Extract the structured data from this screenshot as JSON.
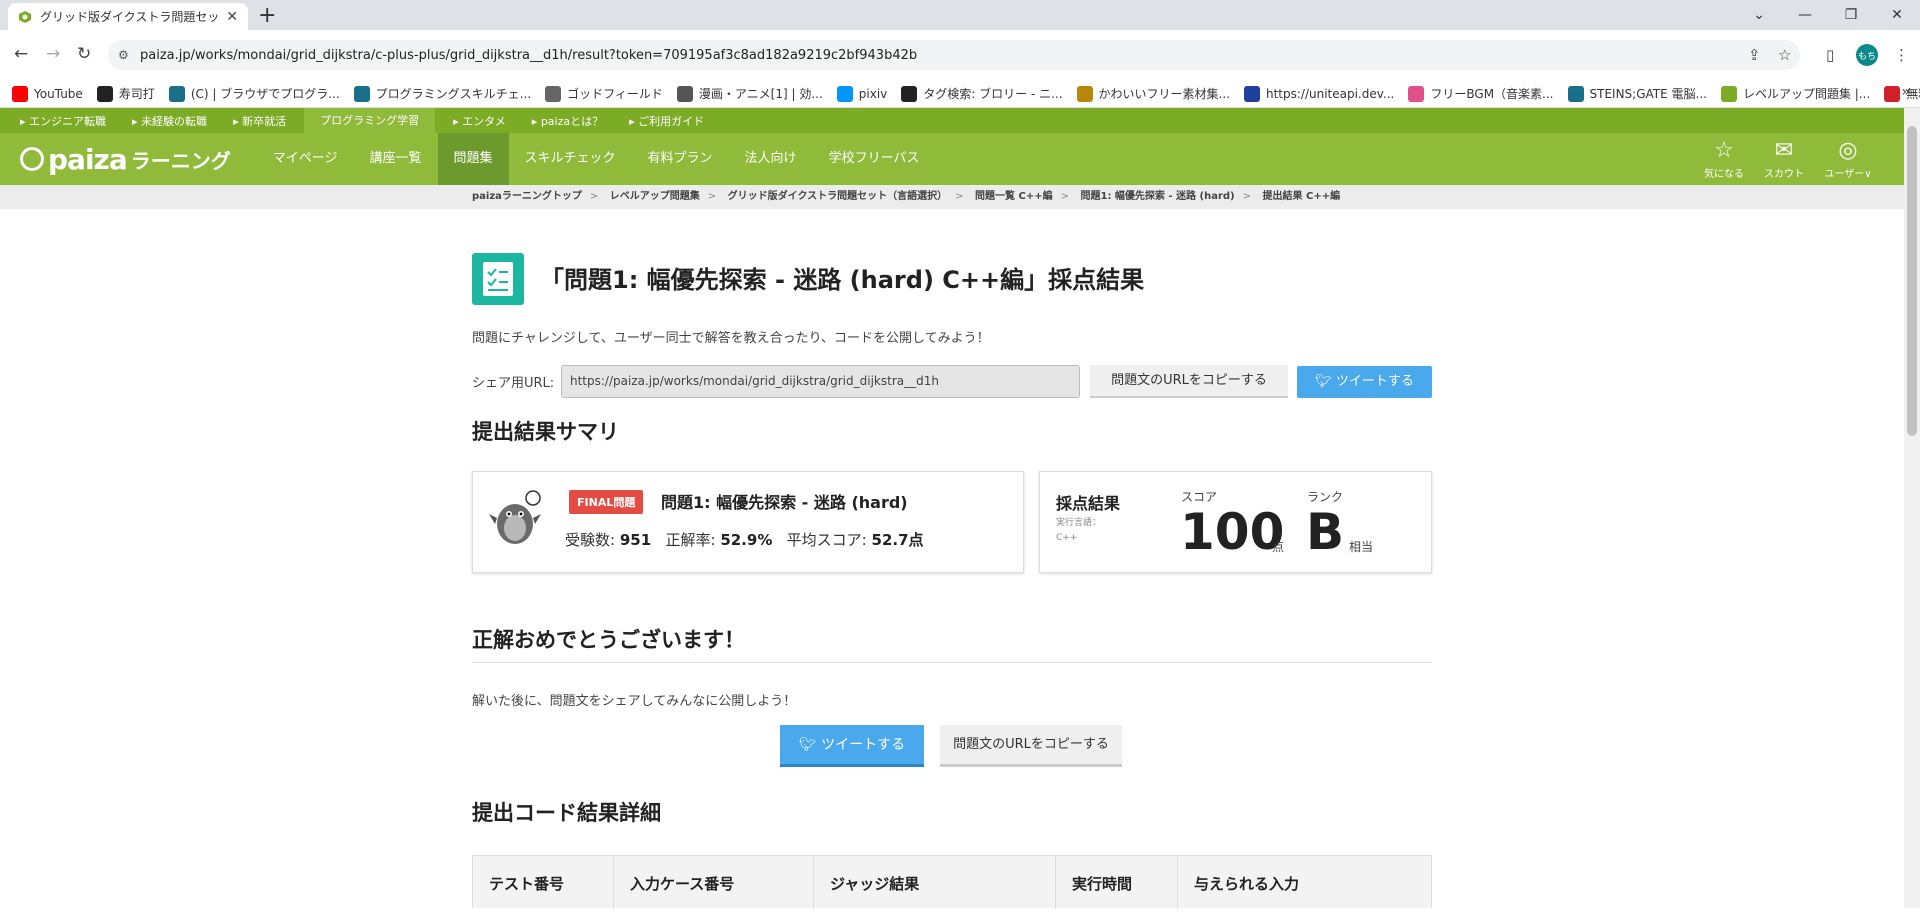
{
  "browser": {
    "tab_title": "グリッド版ダイクストラ問題セット(C++",
    "url": "paiza.jp/works/mondai/grid_dijkstra/c-plus-plus/grid_dijkstra__d1h/result?token=709195af3c8ad182a9219c2bf943b42b",
    "profile_initials": "もち",
    "bookmarks": [
      {
        "label": "YouTube",
        "color": "#ff0000"
      },
      {
        "label": "寿司打",
        "color": "#222222"
      },
      {
        "label": "(C) | ブラウザでプログラ...",
        "color": "#1a6f8a"
      },
      {
        "label": "プログラミングスキルチェ...",
        "color": "#1a6f8a"
      },
      {
        "label": "ゴッドフィールド",
        "color": "#666666"
      },
      {
        "label": "漫画・アニメ[1] | 効...",
        "color": "#555555"
      },
      {
        "label": "pixiv",
        "color": "#0096fa"
      },
      {
        "label": "タグ検索: ブロリー - ニ...",
        "color": "#222222"
      },
      {
        "label": "かわいいフリー素材集...",
        "color": "#b8860b"
      },
      {
        "label": "https://uniteapi.dev...",
        "color": "#2040a0"
      },
      {
        "label": "フリーBGM（音楽素...",
        "color": "#e0508a"
      },
      {
        "label": "STEINS;GATE 電脳...",
        "color": "#1a6f8a"
      },
      {
        "label": "レベルアップ問題集 |...",
        "color": "#7cab26"
      },
      {
        "label": "無料イラストなら「イラ...",
        "color": "#d0202a"
      }
    ]
  },
  "site": {
    "top_links": [
      "エンジニア転職",
      "未経験の転職",
      "新卒就活",
      "プログラミング学習",
      "エンタメ",
      "paizaとは？",
      "ご利用ガイド"
    ],
    "logo_main": "paiza",
    "logo_sub": "ラーニング",
    "main_nav": [
      "マイページ",
      "講座一覧",
      "問題集",
      "スキルチェック",
      "有料プラン",
      "法人向け",
      "学校フリーパス"
    ],
    "right_nav": [
      {
        "label": "気になる",
        "icon": "star-icon"
      },
      {
        "label": "スカウト",
        "icon": "mail-icon"
      },
      {
        "label": "ユーザー∨",
        "icon": "user-icon"
      }
    ],
    "breadcrumbs": [
      "paizaラーニングトップ",
      "レベルアップ問題集",
      "グリッド版ダイクストラ問題セット（言語選択）",
      "問題一覧 C++編",
      "問題1: 幅優先探索 - 迷路 (hard)",
      "提出結果 C++編"
    ]
  },
  "page": {
    "title": "「問題1: 幅優先探索 - 迷路 (hard) C++編」採点結果",
    "lead": "問題にチャレンジして、ユーザー同士で解答を教え合ったり、コードを公開してみよう！",
    "share_label": "シェア用URL:",
    "share_url": "https://paiza.jp/works/mondai/grid_dijkstra/grid_dijkstra__d1h",
    "copy_button": "問題文のURLをコピーする",
    "tweet_button": "ツイートする"
  },
  "summary": {
    "heading": "提出結果サマリ",
    "badge": "FINAL問題",
    "problem_name": "問題1: 幅優先探索 - 迷路 (hard)",
    "examinees_label": "受験数:",
    "examinees": "951",
    "accuracy_label": "正解率:",
    "accuracy": "52.9%",
    "avg_label": "平均スコア:",
    "avg_score": "52.7点",
    "result_label": "採点結果",
    "lang_label": "実行言語：",
    "lang": "C++",
    "score_caption": "スコア",
    "score": "100",
    "score_unit": "点",
    "rank_caption": "ランク",
    "rank": "B",
    "rank_unit": "相当"
  },
  "congrats": {
    "heading": "正解おめでとうございます！",
    "text": "解いた後に、問題文をシェアしてみんなに公開しよう！",
    "tweet_button": "ツイートする",
    "copy_button": "問題文のURLをコピーする"
  },
  "details": {
    "heading": "提出コード結果詳細",
    "columns": [
      "テスト番号",
      "入力ケース番号",
      "ジャッジ結果",
      "実行時間",
      "与えられる入力"
    ]
  },
  "colors": {
    "site_green": "#8fba3a",
    "top_green": "#7cab26",
    "tweet_blue": "#4aa8ec",
    "final_red": "#e44b42",
    "icon_teal": "#1bb7a0"
  }
}
